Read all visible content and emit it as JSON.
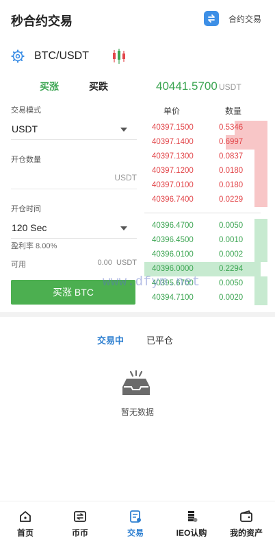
{
  "header": {
    "title": "秒合约交易",
    "switch_label": "合约交易",
    "switch_icon": "swap-icon"
  },
  "pair": {
    "symbol": "BTC/USDT",
    "settings_icon": "gear-icon",
    "chart_icon": "candlestick-icon"
  },
  "trade_tabs": {
    "buy": "买涨",
    "sell": "买跌",
    "active": "buy"
  },
  "ticker": {
    "price": "40441.5700",
    "unit": "USDT"
  },
  "form": {
    "mode_label": "交易模式",
    "mode_value": "USDT",
    "qty_label": "开仓数量",
    "qty_unit": "USDT",
    "time_label": "开仓时间",
    "time_value": "120 Sec",
    "profit_rate": "盈利率 8.00%",
    "available_label": "可用",
    "available_value": "0.00",
    "available_unit": "USDT",
    "submit": "买涨 BTC"
  },
  "orderbook": {
    "price_header": "单价",
    "qty_header": "数量",
    "asks": [
      {
        "price": "40397.1500",
        "qty": "0.5346",
        "depth": 0.28
      },
      {
        "price": "40397.1400",
        "qty": "0.6997",
        "depth": 0.36
      },
      {
        "price": "40397.1300",
        "qty": "0.0837",
        "depth": 0.11
      },
      {
        "price": "40397.1200",
        "qty": "0.0180",
        "depth": 0.11
      },
      {
        "price": "40397.0100",
        "qty": "0.0180",
        "depth": 0.11
      },
      {
        "price": "40396.7400",
        "qty": "0.0229",
        "depth": 0.11
      }
    ],
    "bids": [
      {
        "price": "40396.4700",
        "qty": "0.0050",
        "depth": 0.11
      },
      {
        "price": "40396.4500",
        "qty": "0.0010",
        "depth": 0.11
      },
      {
        "price": "40396.0100",
        "qty": "0.0002",
        "depth": 0.11
      },
      {
        "price": "40396.0000",
        "qty": "0.2294",
        "depth": 1.0
      },
      {
        "price": "40395.6700",
        "qty": "0.0050",
        "depth": 0.11
      },
      {
        "price": "40394.7100",
        "qty": "0.0020",
        "depth": 0.11
      }
    ]
  },
  "watermark": "www.dfym.net",
  "orders": {
    "active_tab": "交易中",
    "closed_tab": "已平仓",
    "empty_text": "暂无数据"
  },
  "nav": [
    {
      "label": "首页",
      "icon": "home-icon"
    },
    {
      "label": "币币",
      "icon": "exchange-icon"
    },
    {
      "label": "交易",
      "icon": "trade-icon",
      "active": true
    },
    {
      "label": "IEO认购",
      "icon": "coins-icon"
    },
    {
      "label": "我的资产",
      "icon": "wallet-icon"
    }
  ],
  "colors": {
    "up": "#3ca552",
    "down": "#e2464a",
    "accent": "#2f80d1",
    "button": "#4caf50"
  }
}
